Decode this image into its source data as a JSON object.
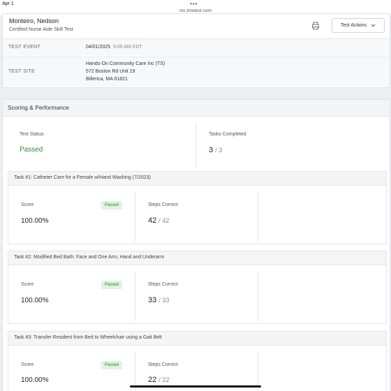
{
  "statusbar": {
    "date": "Apr 1",
    "url": "mc.tmutest.com"
  },
  "header": {
    "candidate_name": "Monteiro, Nedson",
    "test_name": "Certified Nurse Aide Skill Test",
    "actions_label": "Test Actions",
    "event_label": "TEST EVENT",
    "event_date": "04/01/2025",
    "event_time": "9:00 AM EDT",
    "site_label": "TEST SITE",
    "site_name": "Hands-On Community Care Inc (TS)",
    "site_street": "572 Boston Rd Unit 19",
    "site_city": "Billerica, MA 01821"
  },
  "scoring": {
    "title": "Scoring & Performance",
    "status_label": "Test Status",
    "status_value": "Passed",
    "tasks_label": "Tasks Completed",
    "tasks_done": "3",
    "tasks_total": "/ 3",
    "tasks": [
      {
        "title": "Task #1: Catheter Care for a Female w/Hand Washing (7/2023)",
        "score_label": "Score",
        "badge": "Passed",
        "score": "100.00%",
        "steps_label": "Steps Correct",
        "steps": "42",
        "steps_total": "/ 42"
      },
      {
        "title": "Task #2: Modified Bed Bath: Face and One Arm, Hand and Underarm",
        "score_label": "Score",
        "badge": "Passed",
        "score": "100.00%",
        "steps_label": "Steps Correct",
        "steps": "33",
        "steps_total": "/ 33"
      },
      {
        "title": "Task #3: Transfer Resident from Bed to Wheelchair using a Gait Belt",
        "score_label": "Score",
        "badge": "Passed",
        "score": "100.00%",
        "steps_label": "Steps Correct",
        "steps": "22",
        "steps_total": "/ 22"
      }
    ]
  },
  "colors": {
    "passed_text": "#2e8b3a",
    "badge_bg": "#dff3e1",
    "page_bg": "#eceef1"
  },
  "icons": {
    "print": "printer-icon",
    "actions": "chevron-down-icon"
  }
}
